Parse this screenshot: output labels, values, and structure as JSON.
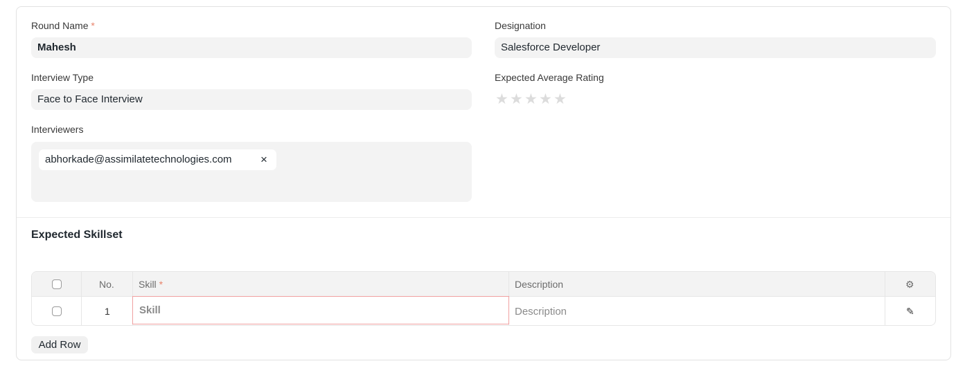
{
  "form": {
    "round_name": {
      "label": "Round Name",
      "required": "*",
      "value": "Mahesh"
    },
    "designation": {
      "label": "Designation",
      "value": "Salesforce Developer"
    },
    "interview_type": {
      "label": "Interview Type",
      "value": "Face to Face Interview"
    },
    "expected_rating": {
      "label": "Expected Average Rating",
      "rating": 0,
      "max": 5
    },
    "interviewers": {
      "label": "Interviewers",
      "chips": [
        {
          "value": "abhorkade@assimilatetechnologies.com",
          "remove": "×"
        }
      ]
    }
  },
  "skillset": {
    "title": "Expected Skillset",
    "columns": {
      "no": "No.",
      "skill": "Skill",
      "skill_required": "*",
      "description": "Description"
    },
    "rows": [
      {
        "no": "1",
        "skill_placeholder": "Skill",
        "description_placeholder": "Description"
      }
    ],
    "add_row": "Add Row"
  },
  "colors": {
    "required": "#e8836b",
    "error_border": "#f0a0a0",
    "input_bg": "#f3f3f3"
  }
}
